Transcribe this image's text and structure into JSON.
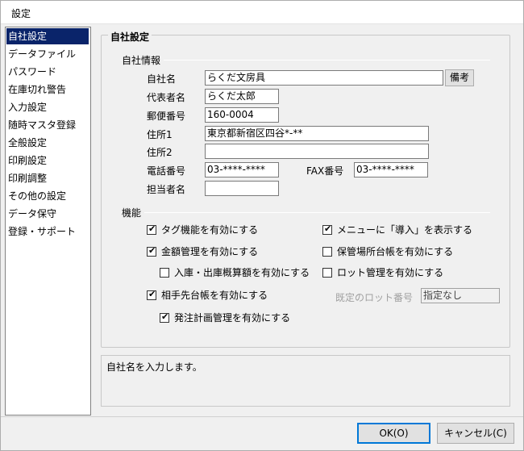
{
  "window": {
    "title": "設定"
  },
  "sidebar": {
    "items": [
      {
        "label": "自社設定",
        "selected": true
      },
      {
        "label": "データファイル"
      },
      {
        "label": "パスワード"
      },
      {
        "label": "在庫切れ警告"
      },
      {
        "label": "入力設定"
      },
      {
        "label": "随時マスタ登録"
      },
      {
        "label": "全般設定"
      },
      {
        "label": "印刷設定"
      },
      {
        "label": "印刷調整"
      },
      {
        "label": "その他の設定"
      },
      {
        "label": "データ保守"
      },
      {
        "label": "登録・サポート"
      }
    ]
  },
  "group": {
    "title": "自社設定",
    "company_info": {
      "section_label": "自社情報",
      "company_name": {
        "label": "自社名",
        "value": "らくだ文房具"
      },
      "notes_button": "備考",
      "representative": {
        "label": "代表者名",
        "value": "らくだ太郎"
      },
      "postal_code": {
        "label": "郵便番号",
        "value": "160-0004"
      },
      "address1": {
        "label": "住所1",
        "value": "東京都新宿区四谷*-**"
      },
      "address2": {
        "label": "住所2",
        "value": ""
      },
      "phone": {
        "label": "電話番号",
        "value": "03-****-****"
      },
      "fax": {
        "label": "FAX番号",
        "value": "03-****-****"
      },
      "contact": {
        "label": "担当者名",
        "value": ""
      }
    },
    "features": {
      "section_label": "機能",
      "tag": {
        "label": "タグ機能を有効にする",
        "checked": true
      },
      "amount": {
        "label": "金額管理を有効にする",
        "checked": true
      },
      "in_out_estimate": {
        "label": "入庫・出庫概算額を有効にする",
        "checked": false
      },
      "partner_ledger": {
        "label": "相手先台帳を有効にする",
        "checked": true
      },
      "order_plan": {
        "label": "発注計画管理を有効にする",
        "checked": true
      },
      "menu_intro": {
        "label": "メニューに「導入」を表示する",
        "checked": true
      },
      "storage_ledger": {
        "label": "保管場所台帳を有効にする",
        "checked": false
      },
      "lot_mgmt": {
        "label": "ロット管理を有効にする",
        "checked": false
      },
      "default_lot": {
        "label": "既定のロット番号",
        "value": "指定なし"
      }
    }
  },
  "help": {
    "text": "自社名を入力します。"
  },
  "buttons": {
    "ok": "OK(O)",
    "cancel": "キャンセル(C)"
  },
  "check_glyph": "✔"
}
